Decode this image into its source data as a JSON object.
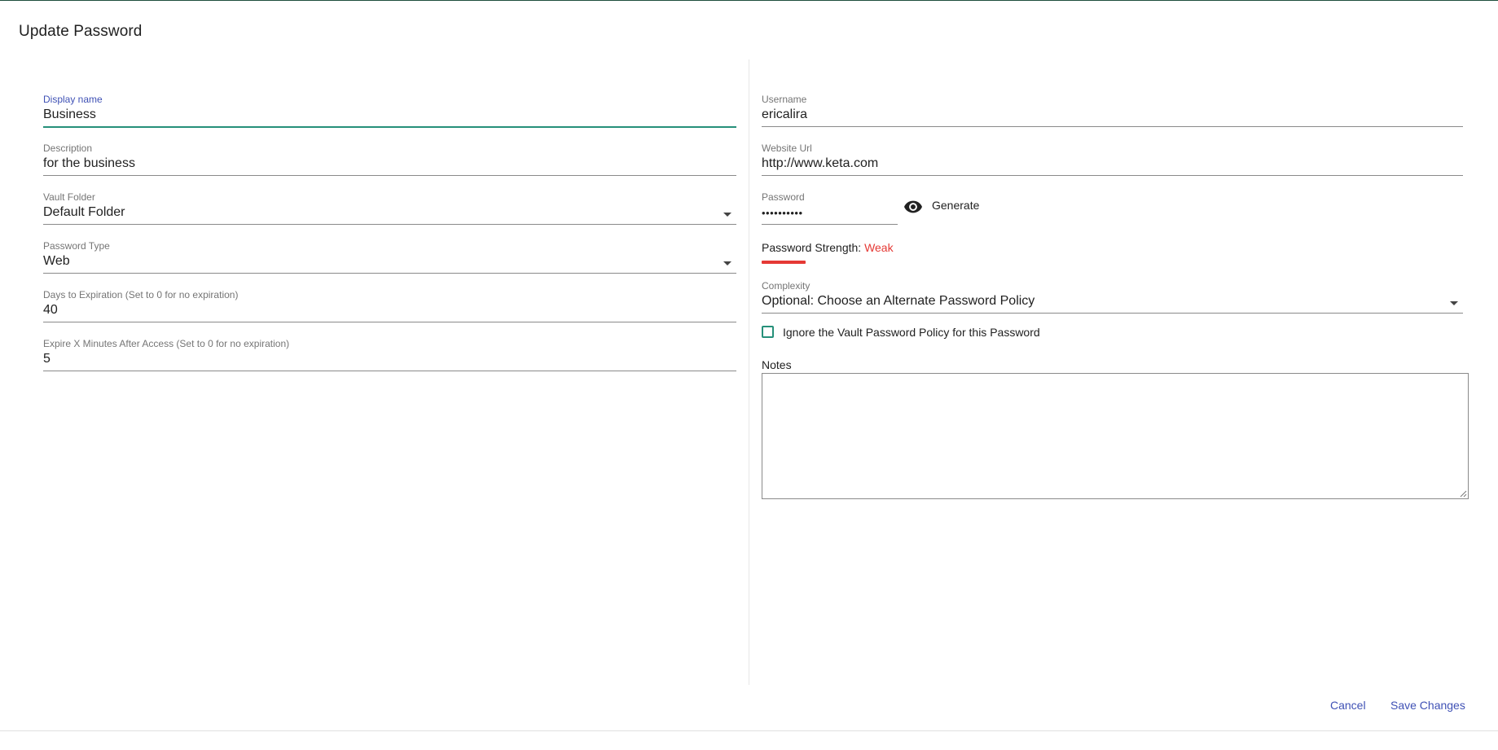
{
  "dialog": {
    "title": "Update Password"
  },
  "left": {
    "display_name": {
      "label": "Display name",
      "value": "Business"
    },
    "description": {
      "label": "Description",
      "value": "for the business"
    },
    "vault_folder": {
      "label": "Vault Folder",
      "value": "Default Folder"
    },
    "password_type": {
      "label": "Password Type",
      "value": "Web"
    },
    "days_to_expiration": {
      "label": "Days to Expiration (Set to 0 for no expiration)",
      "value": "40"
    },
    "expire_minutes": {
      "label": "Expire X Minutes After Access (Set to 0 for no expiration)",
      "value": "5"
    }
  },
  "right": {
    "username": {
      "label": "Username",
      "value": "ericalira"
    },
    "website_url": {
      "label": "Website Url",
      "value": "http://www.keta.com"
    },
    "password": {
      "label": "Password",
      "value": "••••••••••"
    },
    "generate_label": "Generate",
    "strength": {
      "prefix": "Password Strength:",
      "value": "Weak",
      "color": "#e53935"
    },
    "complexity": {
      "label": "Complexity",
      "value": "Optional: Choose an Alternate Password Policy"
    },
    "ignore_policy": {
      "label": "Ignore the Vault Password Policy for this Password",
      "checked": false
    },
    "notes": {
      "label": "Notes",
      "value": ""
    }
  },
  "actions": {
    "cancel": "Cancel",
    "save": "Save Changes"
  },
  "colors": {
    "accent": "#3f51b5",
    "focus_underline": "#26907a",
    "danger": "#e53935"
  },
  "icons": {
    "visibility": "eye-icon",
    "dropdown": "chevron-down-icon"
  }
}
